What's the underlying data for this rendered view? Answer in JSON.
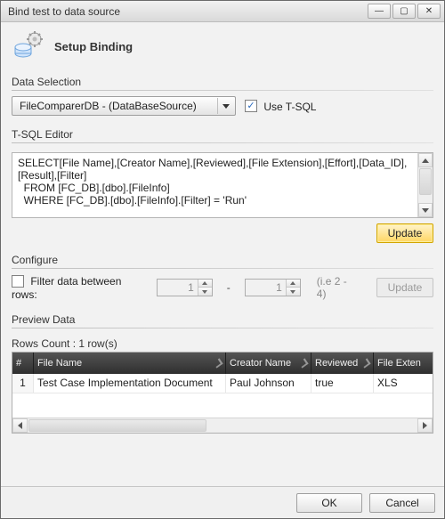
{
  "window": {
    "title": "Bind test to data source"
  },
  "header": {
    "title": "Setup Binding"
  },
  "data_selection": {
    "section": "Data Selection",
    "selected": "FileComparerDB - (DataBaseSource)",
    "use_tsql_label": "Use T-SQL",
    "use_tsql_checked": true
  },
  "tsql_editor": {
    "section": "T-SQL Editor",
    "text": "SELECT[File Name],[Creator Name],[Reviewed],[File Extension],[Effort],[Data_ID],[Result],[Filter]\n  FROM [FC_DB].[dbo].[FileInfo]\n  WHERE [FC_DB].[dbo].[FileInfo].[Filter] = 'Run'",
    "update_label": "Update"
  },
  "configure": {
    "section": "Configure",
    "filter_label": "Filter data between rows:",
    "filter_checked": false,
    "from": "1",
    "to": "1",
    "hint": "(i.e 2 - 4)",
    "update_label": "Update"
  },
  "preview": {
    "section": "Preview Data",
    "rows_count": "Rows Count : 1 row(s)",
    "columns": {
      "num": "#",
      "file_name": "File Name",
      "creator": "Creator Name",
      "reviewed": "Reviewed",
      "file_ext": "File Exten"
    },
    "rows": {
      "0": {
        "num": "1",
        "file_name": "Test Case Implementation Document",
        "creator": "Paul Johnson",
        "reviewed": "true",
        "file_ext": "XLS"
      }
    }
  },
  "footer": {
    "ok": "OK",
    "cancel": "Cancel"
  }
}
